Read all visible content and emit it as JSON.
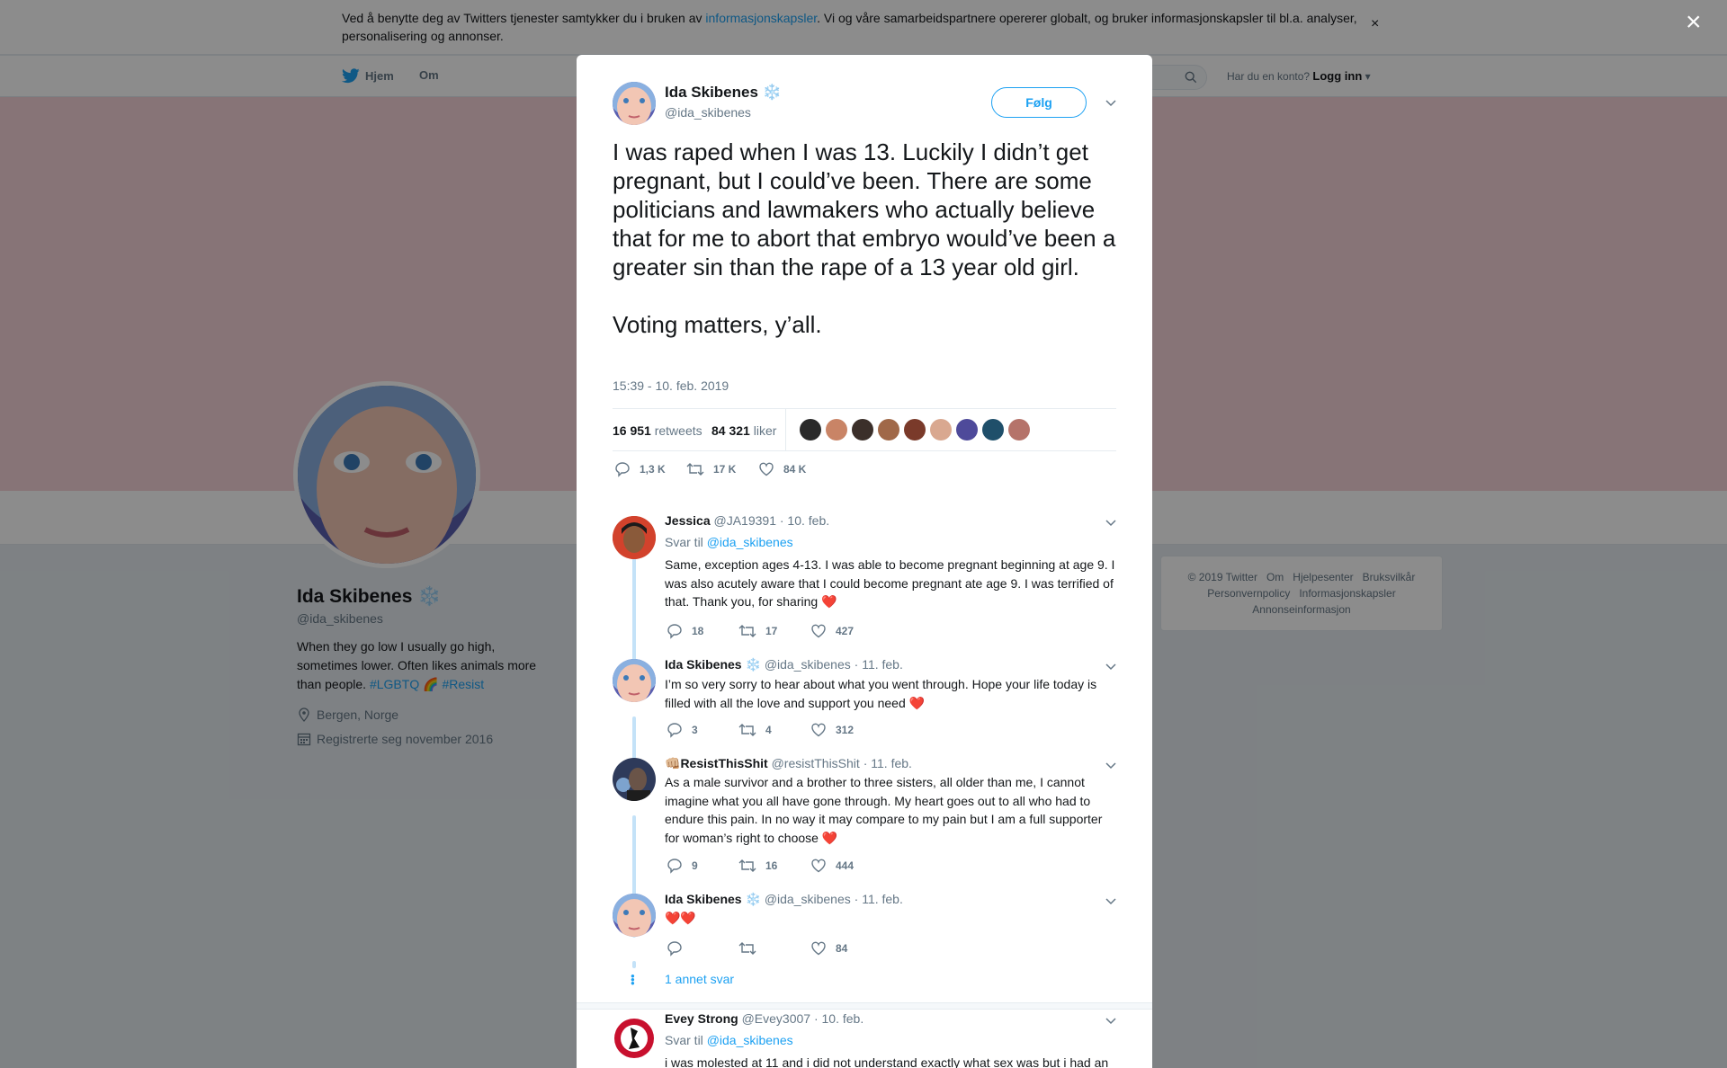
{
  "cookie": {
    "text_before": "Ved å benytte deg av Twitters tjenester samtykker du i bruken av ",
    "link": "informasjonskapsler",
    "text_after": ". Vi og våre samarbeidspartnere opererer globalt, og bruker informasjonskapsler til bl.a. analyser, personalisering og annonser.",
    "close": "×"
  },
  "nav": {
    "home": "Hjem",
    "about": "Om",
    "account_prompt": "Har du en konto?",
    "login": "Logg inn"
  },
  "profile": {
    "name": "Ida Skibenes",
    "badge": "❄️",
    "handle": "@ida_skibenes",
    "bio_text": "When they go low I usually go high, sometimes lower. Often likes animals more than people. ",
    "bio_tag1": "#LGBTQ",
    "bio_rainbow": "🌈",
    "bio_tag2": "#Resist",
    "location": "Bergen, Norge",
    "joined": "Registrerte seg november 2016"
  },
  "footer": {
    "links": [
      "© 2019 Twitter",
      "Om",
      "Hjelpesenter",
      "Bruksvilkår",
      "Personvernpolicy",
      "Informasjonskapsler",
      "Annonseinformasjon"
    ]
  },
  "overlay": {
    "close": "×"
  },
  "tweet": {
    "name": "Ida Skibenes",
    "badge": "❄️",
    "handle": "@ida_skibenes",
    "follow": "Følg",
    "text": "I was raped when I was 13. Luckily I didn’t get pregnant, but I could’ve been. There are some politicians and lawmakers who actually believe that for me to abort that embryo would’ve been a greater sin than the rape of a 13 year old girl.\n\nVoting matters, y’all.",
    "time": "15:39 - 10. feb. 2019",
    "retweets_count": "16 951",
    "retweets_label": "retweets",
    "likes_count": "84 321",
    "likes_label": "liker",
    "reply_count": "1,3 K",
    "retweet_count_short": "17 K",
    "like_count_short": "84 K"
  },
  "replies": [
    {
      "name": "Jessica",
      "badge": "",
      "handle": "@JA19391",
      "date": "· 10. feb.",
      "reply_to_label": "Svar til",
      "reply_to": "@ida_skibenes",
      "text": "Same, exception ages 4-13. I was able to become pregnant beginning at age 9. I was also acutely aware that I could become pregnant ate age 9. I was terrified of that. Thank you, for sharing ",
      "emoji": "❤️",
      "replies": "18",
      "retweets": "17",
      "likes": "427"
    },
    {
      "name": "Ida Skibenes",
      "badge": "❄️",
      "handle": "@ida_skibenes",
      "date": "· 11. feb.",
      "text": "I’m so very sorry to hear about what you went through. Hope your life today is filled with all the love and support you need ",
      "emoji": "❤️",
      "replies": "3",
      "retweets": "4",
      "likes": "312"
    },
    {
      "name": "ResistThisShit",
      "prefix": "👊🏼",
      "handle": "@resistThisShit",
      "date": "· 11. feb.",
      "text": "As a male survivor and a brother to three sisters, all older than me, I cannot imagine what you all have gone through. My heart goes out to all who had to endure this pain.  In no way it may compare to my pain but I am a full supporter for woman’s right to choose ",
      "emoji": "❤️",
      "replies": "9",
      "retweets": "16",
      "likes": "444"
    },
    {
      "name": "Ida Skibenes",
      "badge": "❄️",
      "handle": "@ida_skibenes",
      "date": "· 11. feb.",
      "text": "",
      "emoji": "❤️❤️",
      "replies": "",
      "retweets": "",
      "likes": "84"
    },
    {
      "name": "Evey Strong",
      "handle": "@Evey3007",
      "date": "· 10. feb.",
      "reply_to_label": "Svar til",
      "reply_to": "@ida_skibenes",
      "text": "i was molested at 11 and i did not understand exactly what sex was but i had an"
    }
  ],
  "more_replies": "1 annet svar",
  "colors": {
    "accent": "#1da1f2",
    "banner": "#f6d4d9",
    "heart": "#e0245e"
  },
  "icons": [
    "twitter-bird-icon",
    "search-icon",
    "location-icon",
    "calendar-icon",
    "reply-icon",
    "retweet-icon",
    "like-icon",
    "chevron-down-icon",
    "close-icon"
  ]
}
